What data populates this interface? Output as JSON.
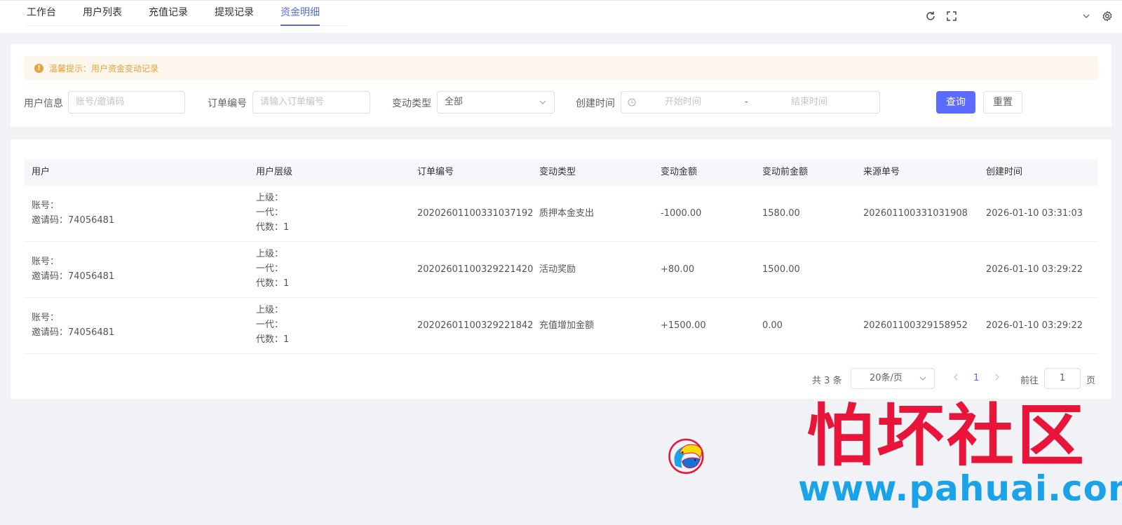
{
  "tabs": [
    "工作台",
    "用户列表",
    "充值记录",
    "提现记录",
    "资金明细"
  ],
  "active_tab": "资金明细",
  "alert": {
    "text": "温馨提示：用户资金变动记录"
  },
  "filters": {
    "user_label": "用户信息",
    "user_placeholder": "账号/邀请码",
    "order_label": "订单编号",
    "order_placeholder": "请输入订单编号",
    "type_label": "变动类型",
    "type_value": "全部",
    "time_label": "创建时间",
    "start_placeholder": "开始时间",
    "sep": "-",
    "end_placeholder": "结束时间",
    "search_btn": "查询",
    "reset_btn": "重置"
  },
  "table": {
    "headers": [
      "用户",
      "用户层级",
      "订单编号",
      "变动类型",
      "变动金额",
      "变动前金额",
      "来源单号",
      "创建时间"
    ],
    "rows": [
      {
        "account": "账号：",
        "invite": "邀请码：74056481",
        "superior": "上级：",
        "gen1": "一代：",
        "gens": "代数：1",
        "order": "20202601100331037192",
        "type": "质押本金支出",
        "amount": "-1000.00",
        "before": "1580.00",
        "source": "202601100331031908",
        "time": "2026-01-10 03:31:03"
      },
      {
        "account": "账号：",
        "invite": "邀请码：74056481",
        "superior": "上级：",
        "gen1": "一代：",
        "gens": "代数：1",
        "order": "20202601100329221420",
        "type": "活动奖励",
        "amount": "+80.00",
        "before": "1500.00",
        "source": "",
        "time": "2026-01-10 03:29:22"
      },
      {
        "account": "账号：",
        "invite": "邀请码：74056481",
        "superior": "上级：",
        "gen1": "一代：",
        "gens": "代数：1",
        "order": "20202601100329221842",
        "type": "充值增加金额",
        "amount": "+1500.00",
        "before": "0.00",
        "source": "202601100329158952",
        "time": "2026-01-10 03:29:22"
      }
    ]
  },
  "pagination": {
    "total": "共 3 条",
    "page_size": "20条/页",
    "current": "1",
    "goto_label": "前往",
    "goto_value": "1",
    "page_unit": "页"
  },
  "watermark": {
    "title": "怕坏社区",
    "url": "www.pahuai.com"
  },
  "colors": {
    "accent": "#5b6bff",
    "warning": "#e6a23c",
    "watermark_red": "#e8143a",
    "watermark_blue": "#1aa3e8"
  }
}
